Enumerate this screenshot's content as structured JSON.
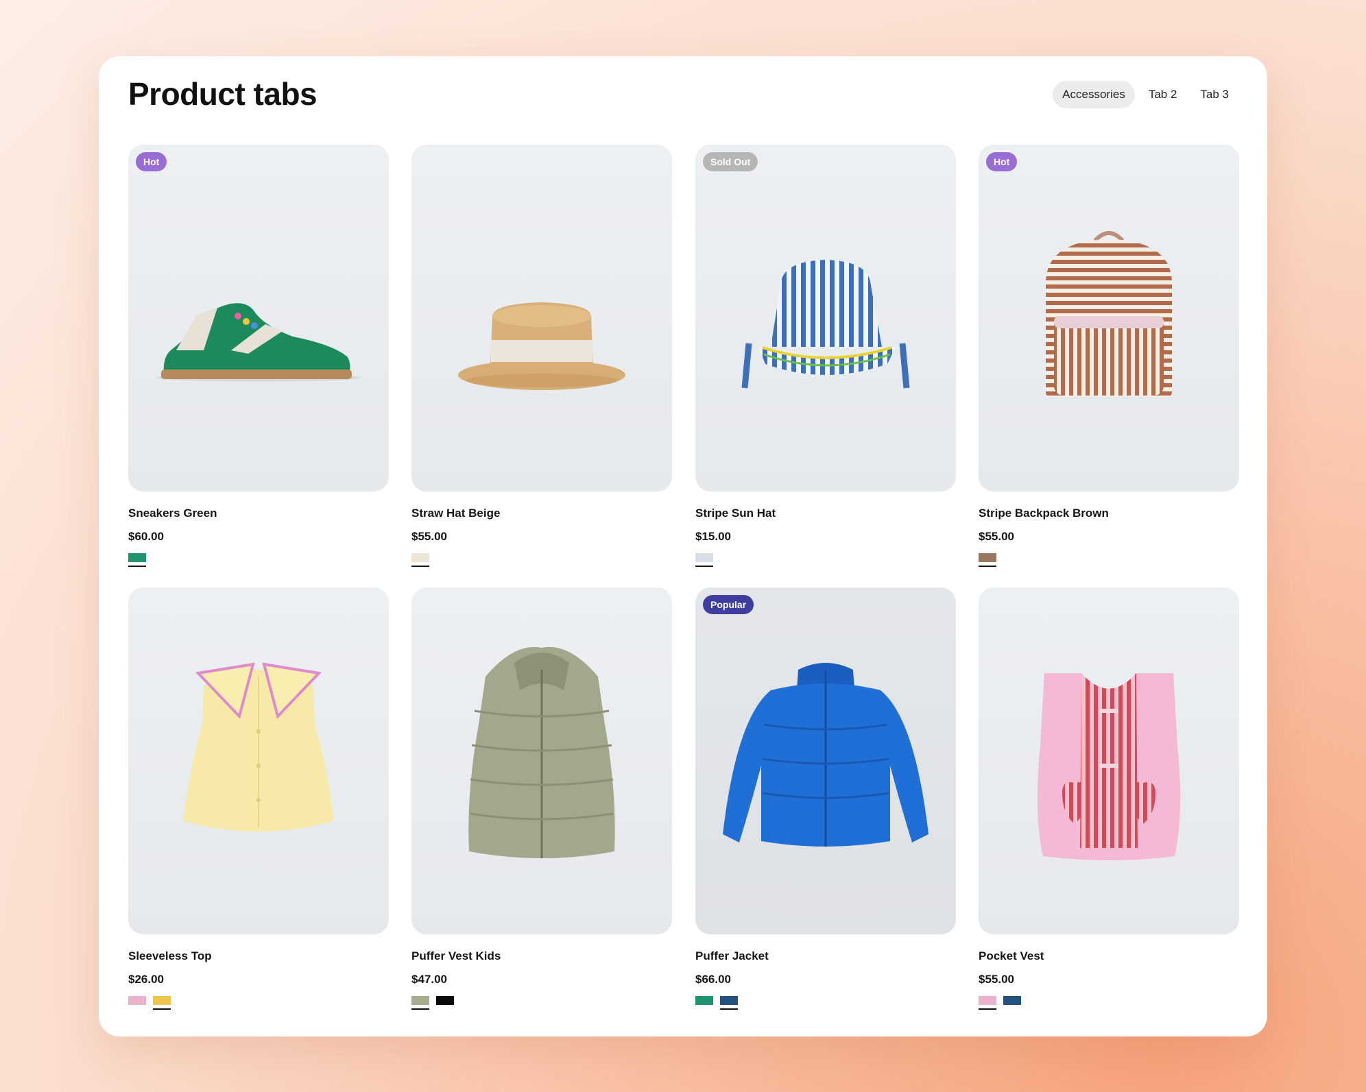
{
  "header": {
    "title": "Product tabs",
    "tabs": [
      {
        "label": "Accessories",
        "active": true
      },
      {
        "label": "Tab 2",
        "active": false
      },
      {
        "label": "Tab 3",
        "active": false
      }
    ]
  },
  "products": [
    {
      "name": "Sneakers Green",
      "price": "$60.00",
      "badge": "Hot",
      "icon": "sneaker-image",
      "swatches": [
        {
          "color": "#1e9470",
          "selected": true
        }
      ]
    },
    {
      "name": "Straw Hat Beige",
      "price": "$55.00",
      "badge": "",
      "icon": "straw-hat-image",
      "swatches": [
        {
          "color": "#ece4d6",
          "selected": true
        }
      ]
    },
    {
      "name": "Stripe Sun Hat",
      "price": "$15.00",
      "badge": "Sold Out",
      "icon": "bucket-hat-image",
      "swatches": [
        {
          "color": "#d8dde6",
          "selected": true
        }
      ]
    },
    {
      "name": "Stripe Backpack Brown",
      "price": "$55.00",
      "badge": "Hot",
      "icon": "backpack-image",
      "swatches": [
        {
          "color": "#9c7760",
          "selected": true
        }
      ]
    },
    {
      "name": "Sleeveless Top",
      "price": "$26.00",
      "badge": "",
      "icon": "sleeveless-top-image",
      "swatches": [
        {
          "color": "#e8b2cb",
          "selected": false
        },
        {
          "color": "#eec64e",
          "selected": true
        }
      ]
    },
    {
      "name": "Puffer Vest Kids",
      "price": "$47.00",
      "badge": "",
      "icon": "puffer-vest-image",
      "swatches": [
        {
          "color": "#a6ad8c",
          "selected": true
        },
        {
          "color": "#0a0a0a",
          "selected": false
        }
      ]
    },
    {
      "name": "Puffer Jacket",
      "price": "$66.00",
      "badge": "Popular",
      "icon": "puffer-jacket-image",
      "swatches": [
        {
          "color": "#1e9470",
          "selected": false
        },
        {
          "color": "#25537f",
          "selected": true
        }
      ]
    },
    {
      "name": "Pocket Vest",
      "price": "$55.00",
      "badge": "",
      "icon": "pocket-vest-image",
      "swatches": [
        {
          "color": "#eab2cd",
          "selected": true
        },
        {
          "color": "#25537f",
          "selected": false
        }
      ]
    }
  ]
}
